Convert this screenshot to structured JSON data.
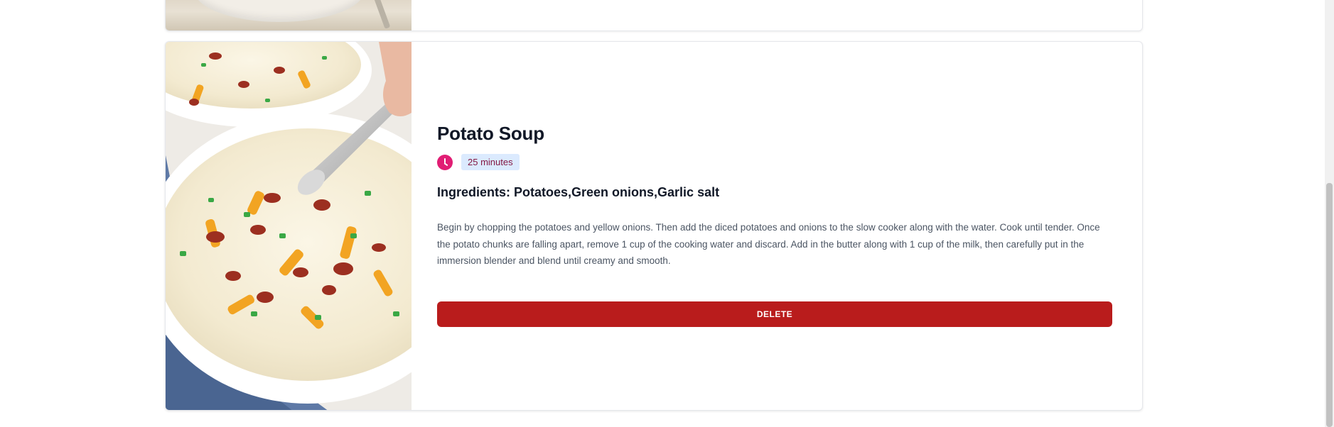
{
  "recipes": [
    {
      "title": "Potato Soup",
      "time": "25 minutes",
      "ingredients": "Ingredients: Potatoes,Green onions,Garlic salt",
      "instructions": "Begin by chopping the potatoes and yellow onions. Then add the diced potatoes and onions to the slow cooker along with the water. Cook until tender. Once the potato chunks are falling apart, remove 1 cup of the cooking water and discard. Add in the butter along with 1 cup of the milk, then carefully put in the immersion blender and blend until creamy and smooth.",
      "delete_label": "DELETE",
      "time_icon": "clock-icon"
    }
  ],
  "colors": {
    "accent_pink": "#e11d74",
    "badge_bg": "#dbeafe",
    "badge_text": "#831843",
    "delete_bg": "#b91c1c",
    "title_text": "#111827",
    "body_text": "#4b5563"
  }
}
